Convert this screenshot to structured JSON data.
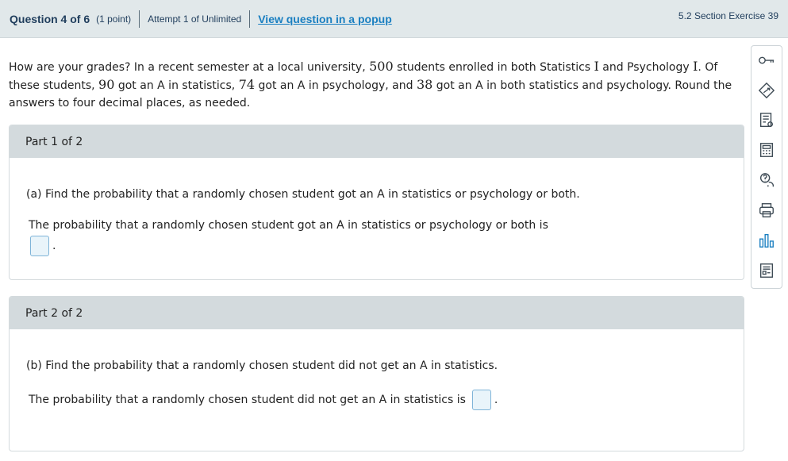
{
  "header": {
    "question_label": "Question 4 of 6",
    "points": "(1 point)",
    "attempt": "Attempt 1 of Unlimited",
    "popup_link": "View question in a popup",
    "section": "5.2 Section Exercise 39"
  },
  "question": {
    "t1": "How are your grades? In a recent semester at a local university, ",
    "n_total": "500",
    "t2": " students enrolled in both Statistics ",
    "roman1": "I",
    "t3": " and Psychology ",
    "roman2": "I",
    "t4": ". Of these students, ",
    "n_stats": "90",
    "t5": " got an A in statistics, ",
    "n_psych": "74",
    "t6": " got an A in psychology, and ",
    "n_both": "38",
    "t7": " got an A in both statistics and psychology. Round the answers to four decimal places, as needed."
  },
  "part1": {
    "title": "Part 1 of 2",
    "question": "(a) Find the probability that a randomly chosen student got an A in statistics or psychology or both.",
    "answer_text": "The probability that a randomly chosen student got an A in statistics or psychology or both is",
    "period": "."
  },
  "part2": {
    "title": "Part 2 of 2",
    "question": "(b) Find the probability that a randomly chosen student did not get an A in statistics.",
    "answer_text": "The probability that a randomly chosen student did not get an A in statistics is",
    "period": "."
  },
  "sidebar": {
    "icons": [
      "key-icon",
      "hint-icon",
      "notes-icon",
      "calculator-icon",
      "help-icon",
      "print-icon",
      "stats-icon",
      "data-icon"
    ]
  },
  "colors": {
    "header_bg": "#e1e8ea",
    "part_header_bg": "#d3dadd",
    "link": "#1a7fc1",
    "title": "#1f3d5c",
    "answer_box_border": "#7fb4d8",
    "answer_box_bg": "#e9f4fa",
    "icon": "#3e4b55"
  }
}
